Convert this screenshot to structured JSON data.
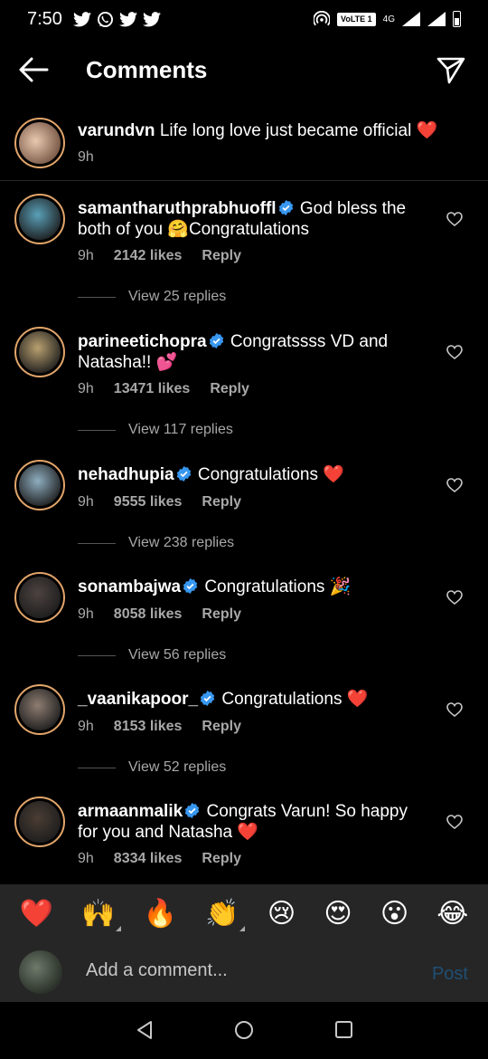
{
  "status": {
    "time": "7:50",
    "left_icons": [
      "twitter-icon",
      "whatsapp-icon",
      "twitter-icon",
      "twitter-icon"
    ],
    "volte": "VoLTE 1",
    "network": "4G"
  },
  "header": {
    "title": "Comments"
  },
  "caption": {
    "username": "varundvn",
    "text": "Life long love just became official ❤️",
    "time": "9h",
    "avatar_color": "#c7a78c"
  },
  "comments": [
    {
      "username": "samantharuthprabhuoffl",
      "verified": true,
      "text": "God bless the both of you 🤗Congratulations",
      "time": "9h",
      "likes": "2142 likes",
      "reply": "Reply",
      "view_replies": "View 25 replies",
      "avatar_color": "#5aa0b8"
    },
    {
      "username": "parineetichopra",
      "verified": true,
      "text": "Congratssss VD and Natasha!! 💕",
      "time": "9h",
      "likes": "13471 likes",
      "reply": "Reply",
      "view_replies": "View 117 replies",
      "avatar_color": "#b9a070"
    },
    {
      "username": "nehadhupia",
      "verified": true,
      "text": "Congratulations ❤️",
      "time": "9h",
      "likes": "9555 likes",
      "reply": "Reply",
      "view_replies": "View 238 replies",
      "avatar_color": "#8faec0"
    },
    {
      "username": "sonambajwa",
      "verified": true,
      "text": "Congratulations 🎉",
      "time": "9h",
      "likes": "8058 likes",
      "reply": "Reply",
      "view_replies": "View 56 replies",
      "avatar_color": "#4d4340"
    },
    {
      "username": "_vaanikapoor_",
      "verified": true,
      "text": "Congratulations ❤️",
      "time": "9h",
      "likes": "8153 likes",
      "reply": "Reply",
      "view_replies": "View 52 replies",
      "avatar_color": "#8e7d72"
    },
    {
      "username": "armaanmalik",
      "verified": true,
      "text": "Congrats Varun! So happy for you and Natasha ❤️",
      "time": "9h",
      "likes": "8334 likes",
      "reply": "Reply",
      "avatar_color": "#4a3d34"
    }
  ],
  "emoji_bar": [
    "❤️",
    "🙌",
    "🔥",
    "👏",
    "😢",
    "😍",
    "😮",
    "😂"
  ],
  "input": {
    "placeholder": "Add a comment...",
    "post_label": "Post"
  },
  "colors": {
    "background": "#000000",
    "bar_background": "#262626",
    "secondary_text": "#a8a8a8",
    "verified": "#3897f0",
    "post_disabled": "#1f4f74",
    "heart": "#ed2b3a"
  }
}
